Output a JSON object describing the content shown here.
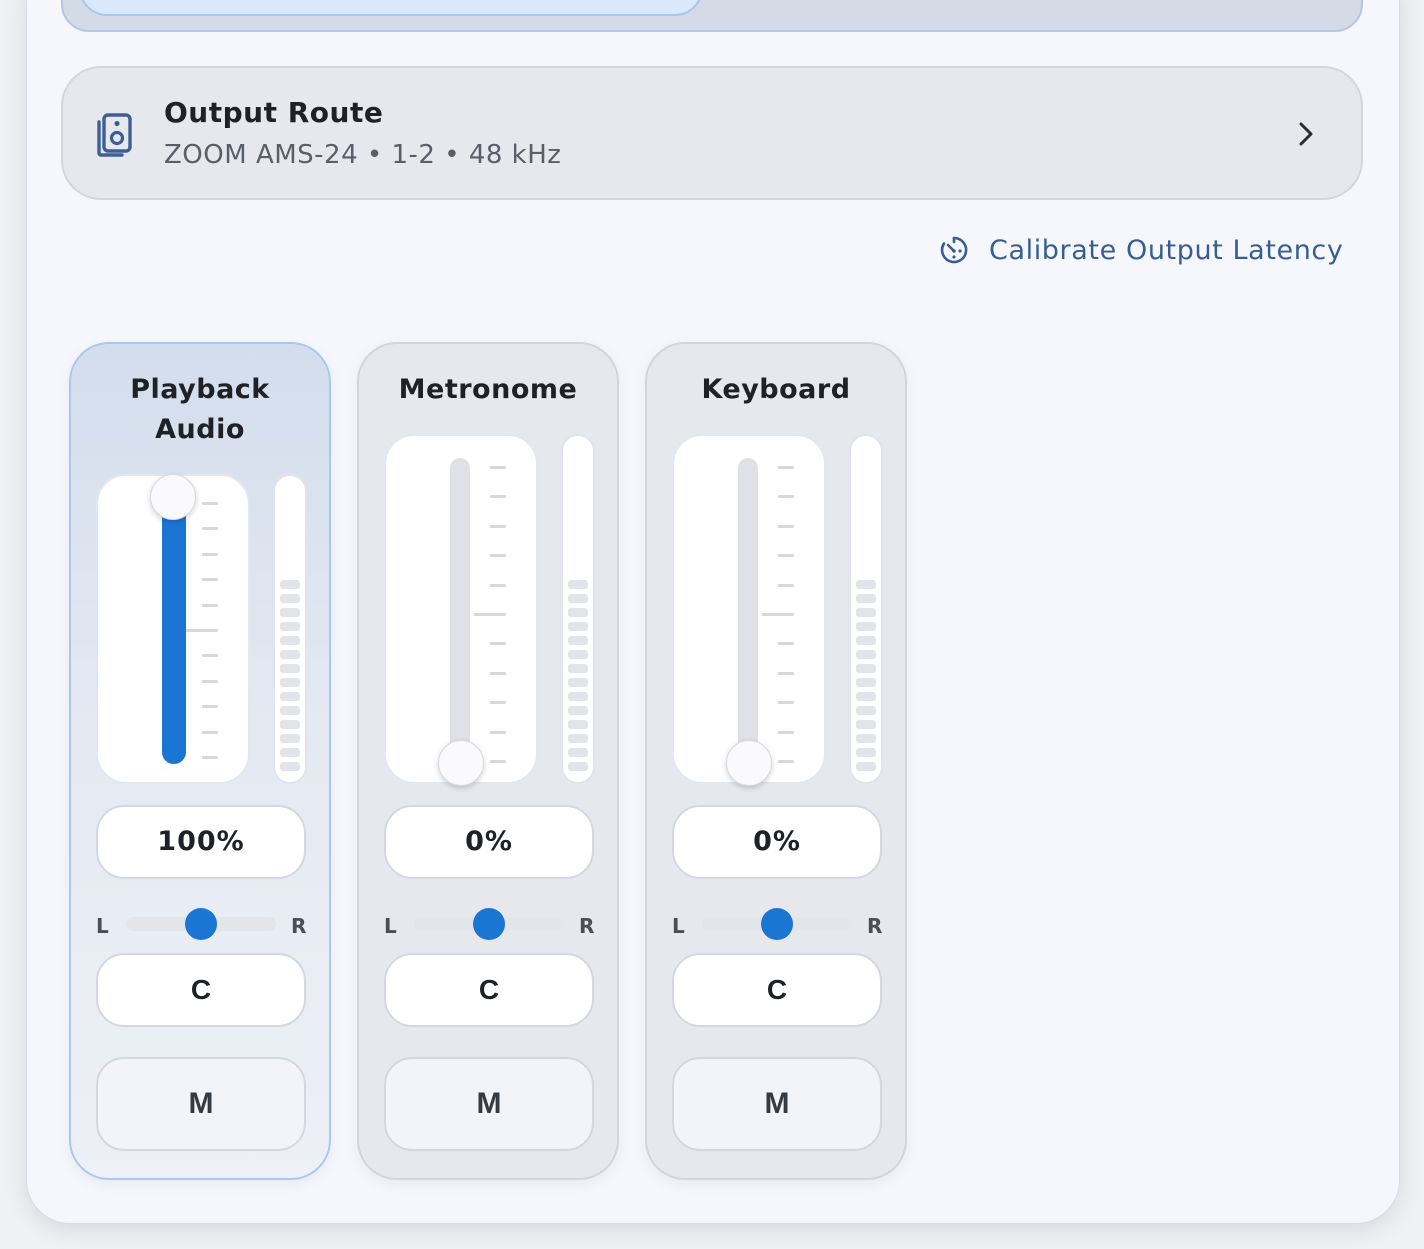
{
  "output_route": {
    "title": "Output Route",
    "subtitle": "ZOOM AMS-24 • 1-2 • 48 kHz",
    "icon": "speaker-icon"
  },
  "calibrate": {
    "label": "Calibrate Output Latency",
    "icon": "timer-icon"
  },
  "channels": [
    {
      "name_line1": "Playback",
      "name_line2": "Audio",
      "volume_label": "100%",
      "volume": 1.0,
      "pan_l": "L",
      "pan_r": "R",
      "pan": 0.5,
      "center_label": "C",
      "mute_label": "M",
      "selected": true
    },
    {
      "name_line1": "Metronome",
      "name_line2": "",
      "volume_label": "0%",
      "volume": 0.0,
      "pan_l": "L",
      "pan_r": "R",
      "pan": 0.5,
      "center_label": "C",
      "mute_label": "M",
      "selected": false
    },
    {
      "name_line1": "Keyboard",
      "name_line2": "",
      "volume_label": "0%",
      "volume": 0.0,
      "pan_l": "L",
      "pan_r": "R",
      "pan": 0.5,
      "center_label": "C",
      "mute_label": "M",
      "selected": false
    }
  ],
  "colors": {
    "accent": "#1a76d2",
    "link": "#375e94",
    "selected_border": "#a9c8ee"
  }
}
